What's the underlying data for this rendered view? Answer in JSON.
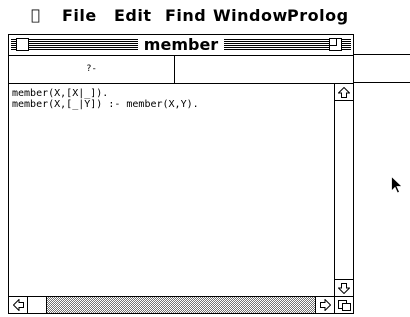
{
  "menubar": {
    "apple_icon": "apple-icon",
    "items": [
      "File",
      "Edit",
      "Find",
      "Window",
      "Prolog"
    ]
  },
  "window": {
    "title": "member",
    "query_prompt": "?-",
    "query_value": "",
    "code_lines": [
      "member(X,[X|_]).",
      "member(X,[_|Y]) :- member(X,Y)."
    ]
  }
}
